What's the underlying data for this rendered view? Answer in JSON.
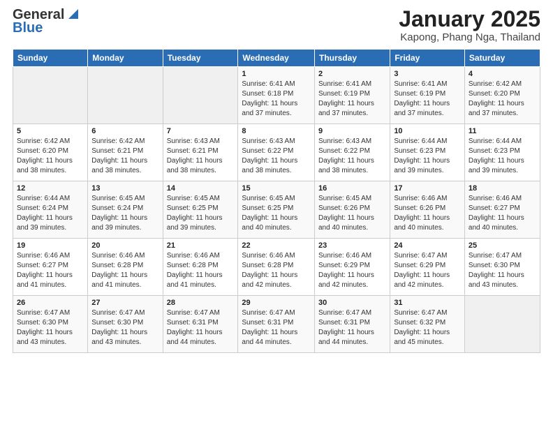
{
  "logo": {
    "general": "General",
    "blue": "Blue"
  },
  "title": "January 2025",
  "subtitle": "Kapong, Phang Nga, Thailand",
  "days_of_week": [
    "Sunday",
    "Monday",
    "Tuesday",
    "Wednesday",
    "Thursday",
    "Friday",
    "Saturday"
  ],
  "weeks": [
    [
      {
        "day": "",
        "sunrise": "",
        "sunset": "",
        "daylight": "",
        "empty": true
      },
      {
        "day": "",
        "sunrise": "",
        "sunset": "",
        "daylight": "",
        "empty": true
      },
      {
        "day": "",
        "sunrise": "",
        "sunset": "",
        "daylight": "",
        "empty": true
      },
      {
        "day": "1",
        "sunrise": "Sunrise: 6:41 AM",
        "sunset": "Sunset: 6:18 PM",
        "daylight": "Daylight: 11 hours and 37 minutes."
      },
      {
        "day": "2",
        "sunrise": "Sunrise: 6:41 AM",
        "sunset": "Sunset: 6:19 PM",
        "daylight": "Daylight: 11 hours and 37 minutes."
      },
      {
        "day": "3",
        "sunrise": "Sunrise: 6:41 AM",
        "sunset": "Sunset: 6:19 PM",
        "daylight": "Daylight: 11 hours and 37 minutes."
      },
      {
        "day": "4",
        "sunrise": "Sunrise: 6:42 AM",
        "sunset": "Sunset: 6:20 PM",
        "daylight": "Daylight: 11 hours and 37 minutes."
      }
    ],
    [
      {
        "day": "5",
        "sunrise": "Sunrise: 6:42 AM",
        "sunset": "Sunset: 6:20 PM",
        "daylight": "Daylight: 11 hours and 38 minutes."
      },
      {
        "day": "6",
        "sunrise": "Sunrise: 6:42 AM",
        "sunset": "Sunset: 6:21 PM",
        "daylight": "Daylight: 11 hours and 38 minutes."
      },
      {
        "day": "7",
        "sunrise": "Sunrise: 6:43 AM",
        "sunset": "Sunset: 6:21 PM",
        "daylight": "Daylight: 11 hours and 38 minutes."
      },
      {
        "day": "8",
        "sunrise": "Sunrise: 6:43 AM",
        "sunset": "Sunset: 6:22 PM",
        "daylight": "Daylight: 11 hours and 38 minutes."
      },
      {
        "day": "9",
        "sunrise": "Sunrise: 6:43 AM",
        "sunset": "Sunset: 6:22 PM",
        "daylight": "Daylight: 11 hours and 38 minutes."
      },
      {
        "day": "10",
        "sunrise": "Sunrise: 6:44 AM",
        "sunset": "Sunset: 6:23 PM",
        "daylight": "Daylight: 11 hours and 39 minutes."
      },
      {
        "day": "11",
        "sunrise": "Sunrise: 6:44 AM",
        "sunset": "Sunset: 6:23 PM",
        "daylight": "Daylight: 11 hours and 39 minutes."
      }
    ],
    [
      {
        "day": "12",
        "sunrise": "Sunrise: 6:44 AM",
        "sunset": "Sunset: 6:24 PM",
        "daylight": "Daylight: 11 hours and 39 minutes."
      },
      {
        "day": "13",
        "sunrise": "Sunrise: 6:45 AM",
        "sunset": "Sunset: 6:24 PM",
        "daylight": "Daylight: 11 hours and 39 minutes."
      },
      {
        "day": "14",
        "sunrise": "Sunrise: 6:45 AM",
        "sunset": "Sunset: 6:25 PM",
        "daylight": "Daylight: 11 hours and 39 minutes."
      },
      {
        "day": "15",
        "sunrise": "Sunrise: 6:45 AM",
        "sunset": "Sunset: 6:25 PM",
        "daylight": "Daylight: 11 hours and 40 minutes."
      },
      {
        "day": "16",
        "sunrise": "Sunrise: 6:45 AM",
        "sunset": "Sunset: 6:26 PM",
        "daylight": "Daylight: 11 hours and 40 minutes."
      },
      {
        "day": "17",
        "sunrise": "Sunrise: 6:46 AM",
        "sunset": "Sunset: 6:26 PM",
        "daylight": "Daylight: 11 hours and 40 minutes."
      },
      {
        "day": "18",
        "sunrise": "Sunrise: 6:46 AM",
        "sunset": "Sunset: 6:27 PM",
        "daylight": "Daylight: 11 hours and 40 minutes."
      }
    ],
    [
      {
        "day": "19",
        "sunrise": "Sunrise: 6:46 AM",
        "sunset": "Sunset: 6:27 PM",
        "daylight": "Daylight: 11 hours and 41 minutes."
      },
      {
        "day": "20",
        "sunrise": "Sunrise: 6:46 AM",
        "sunset": "Sunset: 6:28 PM",
        "daylight": "Daylight: 11 hours and 41 minutes."
      },
      {
        "day": "21",
        "sunrise": "Sunrise: 6:46 AM",
        "sunset": "Sunset: 6:28 PM",
        "daylight": "Daylight: 11 hours and 41 minutes."
      },
      {
        "day": "22",
        "sunrise": "Sunrise: 6:46 AM",
        "sunset": "Sunset: 6:28 PM",
        "daylight": "Daylight: 11 hours and 42 minutes."
      },
      {
        "day": "23",
        "sunrise": "Sunrise: 6:46 AM",
        "sunset": "Sunset: 6:29 PM",
        "daylight": "Daylight: 11 hours and 42 minutes."
      },
      {
        "day": "24",
        "sunrise": "Sunrise: 6:47 AM",
        "sunset": "Sunset: 6:29 PM",
        "daylight": "Daylight: 11 hours and 42 minutes."
      },
      {
        "day": "25",
        "sunrise": "Sunrise: 6:47 AM",
        "sunset": "Sunset: 6:30 PM",
        "daylight": "Daylight: 11 hours and 43 minutes."
      }
    ],
    [
      {
        "day": "26",
        "sunrise": "Sunrise: 6:47 AM",
        "sunset": "Sunset: 6:30 PM",
        "daylight": "Daylight: 11 hours and 43 minutes."
      },
      {
        "day": "27",
        "sunrise": "Sunrise: 6:47 AM",
        "sunset": "Sunset: 6:30 PM",
        "daylight": "Daylight: 11 hours and 43 minutes."
      },
      {
        "day": "28",
        "sunrise": "Sunrise: 6:47 AM",
        "sunset": "Sunset: 6:31 PM",
        "daylight": "Daylight: 11 hours and 44 minutes."
      },
      {
        "day": "29",
        "sunrise": "Sunrise: 6:47 AM",
        "sunset": "Sunset: 6:31 PM",
        "daylight": "Daylight: 11 hours and 44 minutes."
      },
      {
        "day": "30",
        "sunrise": "Sunrise: 6:47 AM",
        "sunset": "Sunset: 6:31 PM",
        "daylight": "Daylight: 11 hours and 44 minutes."
      },
      {
        "day": "31",
        "sunrise": "Sunrise: 6:47 AM",
        "sunset": "Sunset: 6:32 PM",
        "daylight": "Daylight: 11 hours and 45 minutes."
      },
      {
        "day": "",
        "sunrise": "",
        "sunset": "",
        "daylight": "",
        "empty": true
      }
    ]
  ]
}
